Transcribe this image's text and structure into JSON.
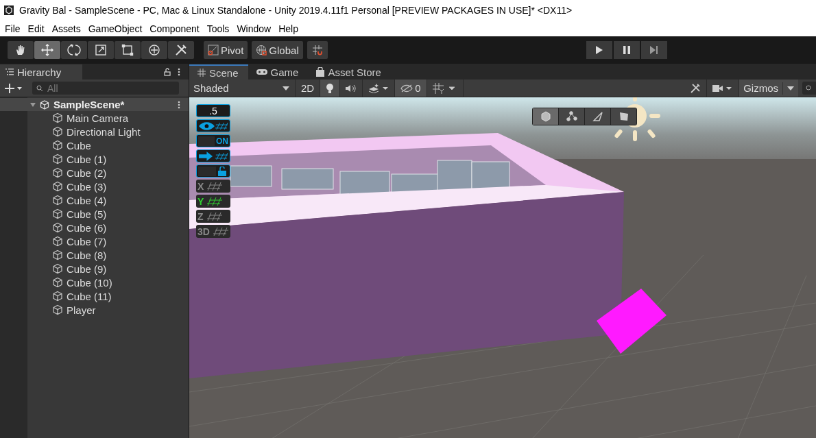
{
  "window": {
    "title": "Gravity Bal - SampleScene - PC, Mac & Linux Standalone - Unity 2019.4.11f1 Personal [PREVIEW PACKAGES IN USE]* <DX11>"
  },
  "menu": [
    "File",
    "Edit",
    "Assets",
    "GameObject",
    "Component",
    "Tools",
    "Window",
    "Help"
  ],
  "tools": [
    {
      "kind": "hand",
      "selected": false
    },
    {
      "kind": "move",
      "selected": true
    },
    {
      "kind": "rotate",
      "selected": false
    },
    {
      "kind": "scale",
      "selected": false
    },
    {
      "kind": "rect",
      "selected": false
    },
    {
      "kind": "transform",
      "selected": false
    },
    {
      "kind": "custom",
      "selected": false
    }
  ],
  "pivot": "Pivot",
  "global": "Global",
  "hierarchy": {
    "tab": "Hierarchy",
    "search_placeholder": "All",
    "scene": {
      "name": "SampleScene*",
      "expanded": true,
      "children": [
        {
          "name": "Main Camera"
        },
        {
          "name": "Directional Light"
        },
        {
          "name": "Cube"
        },
        {
          "name": "Cube (1)"
        },
        {
          "name": "Cube (2)"
        },
        {
          "name": "Cube (3)"
        },
        {
          "name": "Cube (4)"
        },
        {
          "name": "Cube (5)"
        },
        {
          "name": "Cube (6)"
        },
        {
          "name": "Cube (7)"
        },
        {
          "name": "Cube (8)"
        },
        {
          "name": "Cube (9)"
        },
        {
          "name": "Cube (10)"
        },
        {
          "name": "Cube (11)"
        },
        {
          "name": "Player"
        }
      ]
    }
  },
  "scene_tabs": [
    {
      "label": "Scene",
      "kind": "scene",
      "selected": true
    },
    {
      "label": "Game",
      "kind": "game",
      "selected": false
    },
    {
      "label": "Asset Store",
      "kind": "store",
      "selected": false
    }
  ],
  "scene_toolbar": {
    "shading": "Shaded",
    "mode_2d": "2D",
    "hidden_count": "0",
    "gizmos": "Gizmos"
  },
  "overlay": [
    {
      "kind": "value",
      "text": ".5"
    },
    {
      "kind": "eye",
      "on": true
    },
    {
      "kind": "toggle",
      "text": "ON",
      "on": true
    },
    {
      "kind": "arrow",
      "on": true
    },
    {
      "kind": "lock",
      "on": true
    },
    {
      "kind": "axis",
      "text": "X",
      "selected": false
    },
    {
      "kind": "axis",
      "text": "Y",
      "selected": true
    },
    {
      "kind": "axis",
      "text": "Z",
      "selected": false
    },
    {
      "kind": "axis",
      "text": "3D",
      "selected": false
    }
  ],
  "view_modes": [
    {
      "kind": "cube",
      "selected": true
    },
    {
      "kind": "nodes",
      "selected": false
    },
    {
      "kind": "triangle",
      "selected": false
    },
    {
      "kind": "face",
      "selected": false
    }
  ]
}
